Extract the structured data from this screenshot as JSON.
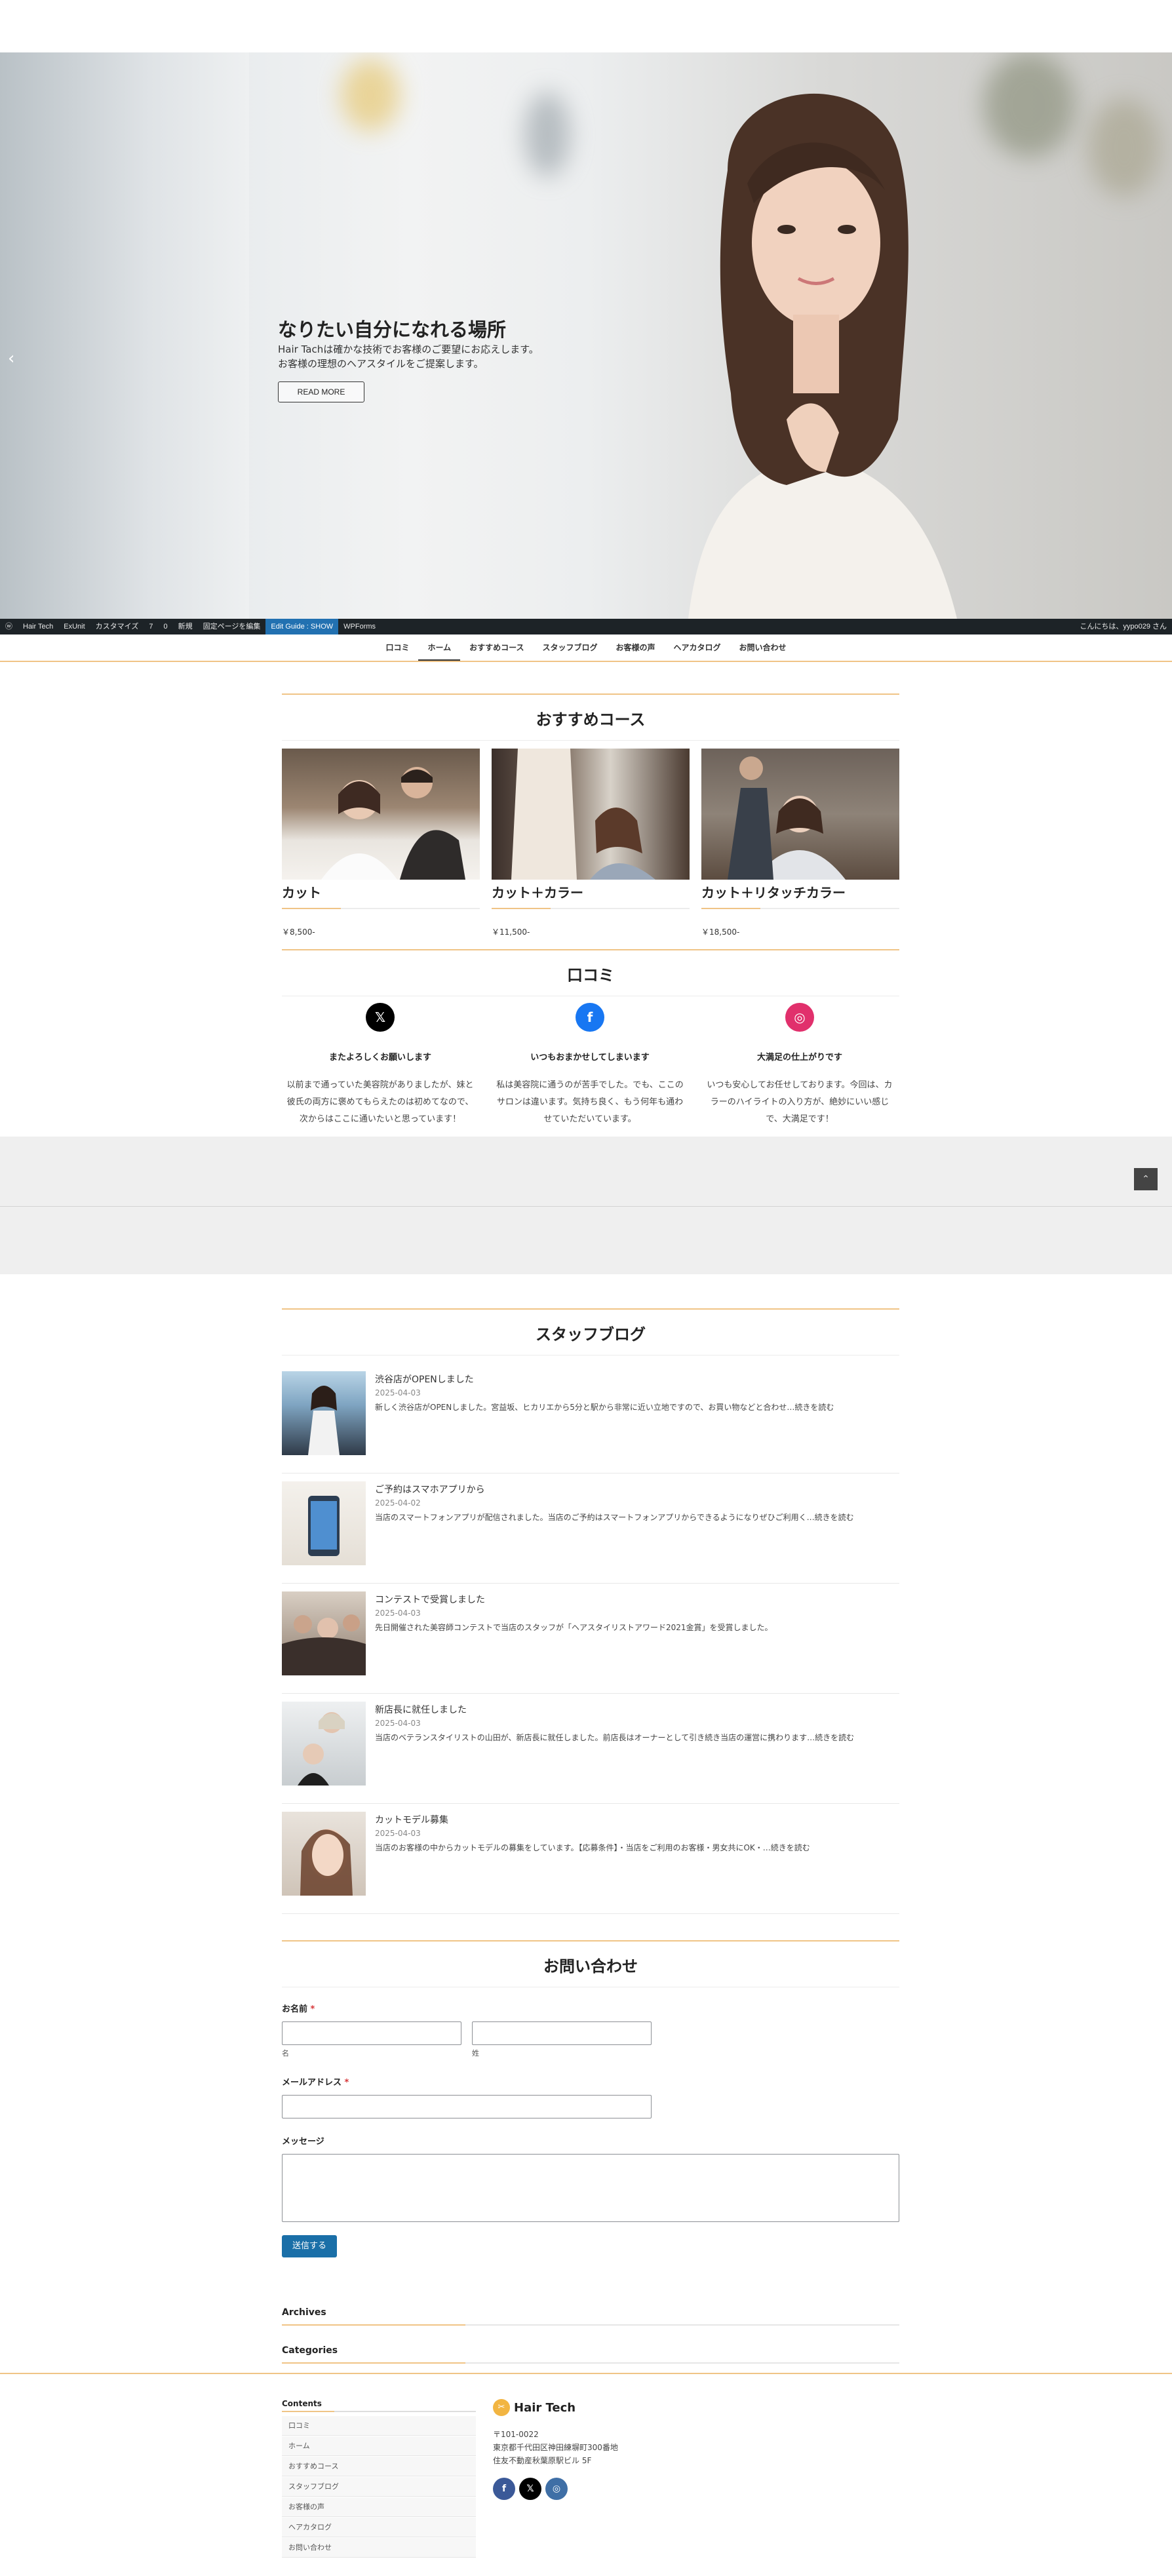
{
  "hero": {
    "headline": "なりたい自分になれる場所",
    "line1": "Hair Tachは確かな技術でお客様のご要望にお応えします。",
    "line2": "お客様の理想のヘアスタイルをご提案します。",
    "button": "READ MORE",
    "prev_arrow": "‹"
  },
  "adminbar": {
    "items": [
      "Hair Tech",
      "ExUnit",
      "カスタマイズ",
      "7",
      "0",
      "新規",
      "固定ページを編集",
      "Edit Guide : SHOW",
      "WPForms"
    ],
    "greeting": "こんにちは、yypo029 さん"
  },
  "nav": [
    "口コミ",
    "ホーム",
    "おすすめコース",
    "スタッフブログ",
    "お客様の声",
    "ヘアカタログ",
    "お問い合わせ"
  ],
  "courses": {
    "heading": "おすすめコース",
    "items": [
      {
        "title": "カット",
        "price": "￥8,500-"
      },
      {
        "title": "カット＋カラー",
        "price": "￥11,500-"
      },
      {
        "title": "カット＋リタッチカラー",
        "price": "￥18,500-"
      }
    ]
  },
  "reviews": {
    "heading": "口コミ",
    "items": [
      {
        "icon": "x-icon",
        "title": "またよろしくお願いします",
        "l1": "以前まで通っていた美容院がありましたが、妹と",
        "l2": "彼氏の両方に褒めてもらえたのは初めてなので、",
        "l3": "次からはここに通いたいと思っています！"
      },
      {
        "icon": "facebook-icon",
        "title": "いつもおまかせしてしまいます",
        "l1": "私は美容院に通うのが苦手でした。でも、ここの",
        "l2": "サロンは違います。気持ち良く、もう何年も通わ",
        "l3": "せていただいています。"
      },
      {
        "icon": "instagram-icon",
        "title": "大満足の仕上がりです",
        "l1": "いつも安心してお任せしております。今回は、カ",
        "l2": "ラーのハイライトの入り方が、絶妙にいい感じ",
        "l3": "で、大満足です！"
      }
    ]
  },
  "blog": {
    "heading": "スタッフブログ",
    "posts": [
      {
        "title": "渋谷店がOPENしました",
        "date": "2025-04-03",
        "excerpt": "新しく渋谷店がOPENしました。宮益坂、ヒカリエから5分と駅から非常に近い立地ですので、お買い物などと合わせ…続きを読む"
      },
      {
        "title": "ご予約はスマホアプリから",
        "date": "2025-04-02",
        "excerpt": "当店のスマートフォンアプリが配信されました。当店のご予約はスマートフォンアプリからできるようになりぜひご利用く…続きを読む"
      },
      {
        "title": "コンテストで受賞しました",
        "date": "2025-04-03",
        "excerpt": "先日開催された美容師コンテストで当店のスタッフが「ヘアスタイリストアワード2021金賞」を受賞しました。"
      },
      {
        "title": "新店長に就任しました",
        "date": "2025-04-03",
        "excerpt": "当店のベテランスタイリストの山田が、新店長に就任しました。前店長はオーナーとして引き続き当店の運営に携わります…続きを読む"
      },
      {
        "title": "カットモデル募集",
        "date": "2025-04-03",
        "excerpt": "当店のお客様の中からカットモデルの募集をしています。【応募条件】・当店をご利用のお客様・男女共にOK・…続きを読む"
      }
    ]
  },
  "contact": {
    "heading": "お問い合わせ",
    "name_label": "お名前",
    "required_mark": "*",
    "first_sub": "名",
    "last_sub": "姓",
    "email_label": "メールアドレス",
    "message_label": "メッセージ",
    "submit": "送信する"
  },
  "widgets": {
    "archives": "Archives",
    "categories": "Categories"
  },
  "footer": {
    "contents_heading": "Contents",
    "links": [
      "口コミ",
      "ホーム",
      "おすすめコース",
      "スタッフブログ",
      "お客様の声",
      "ヘアカタログ",
      "お問い合わせ"
    ],
    "brand": "Hair Tech",
    "zip": "〒101-0022",
    "addr1": "東京都千代田区神田練塀町300番地",
    "addr2": "住友不動産秋葉原駅ビル 5F"
  },
  "colors": {
    "accent": "#f0c486",
    "adminbar": "#1d2327",
    "submit": "#1a6fa8"
  }
}
